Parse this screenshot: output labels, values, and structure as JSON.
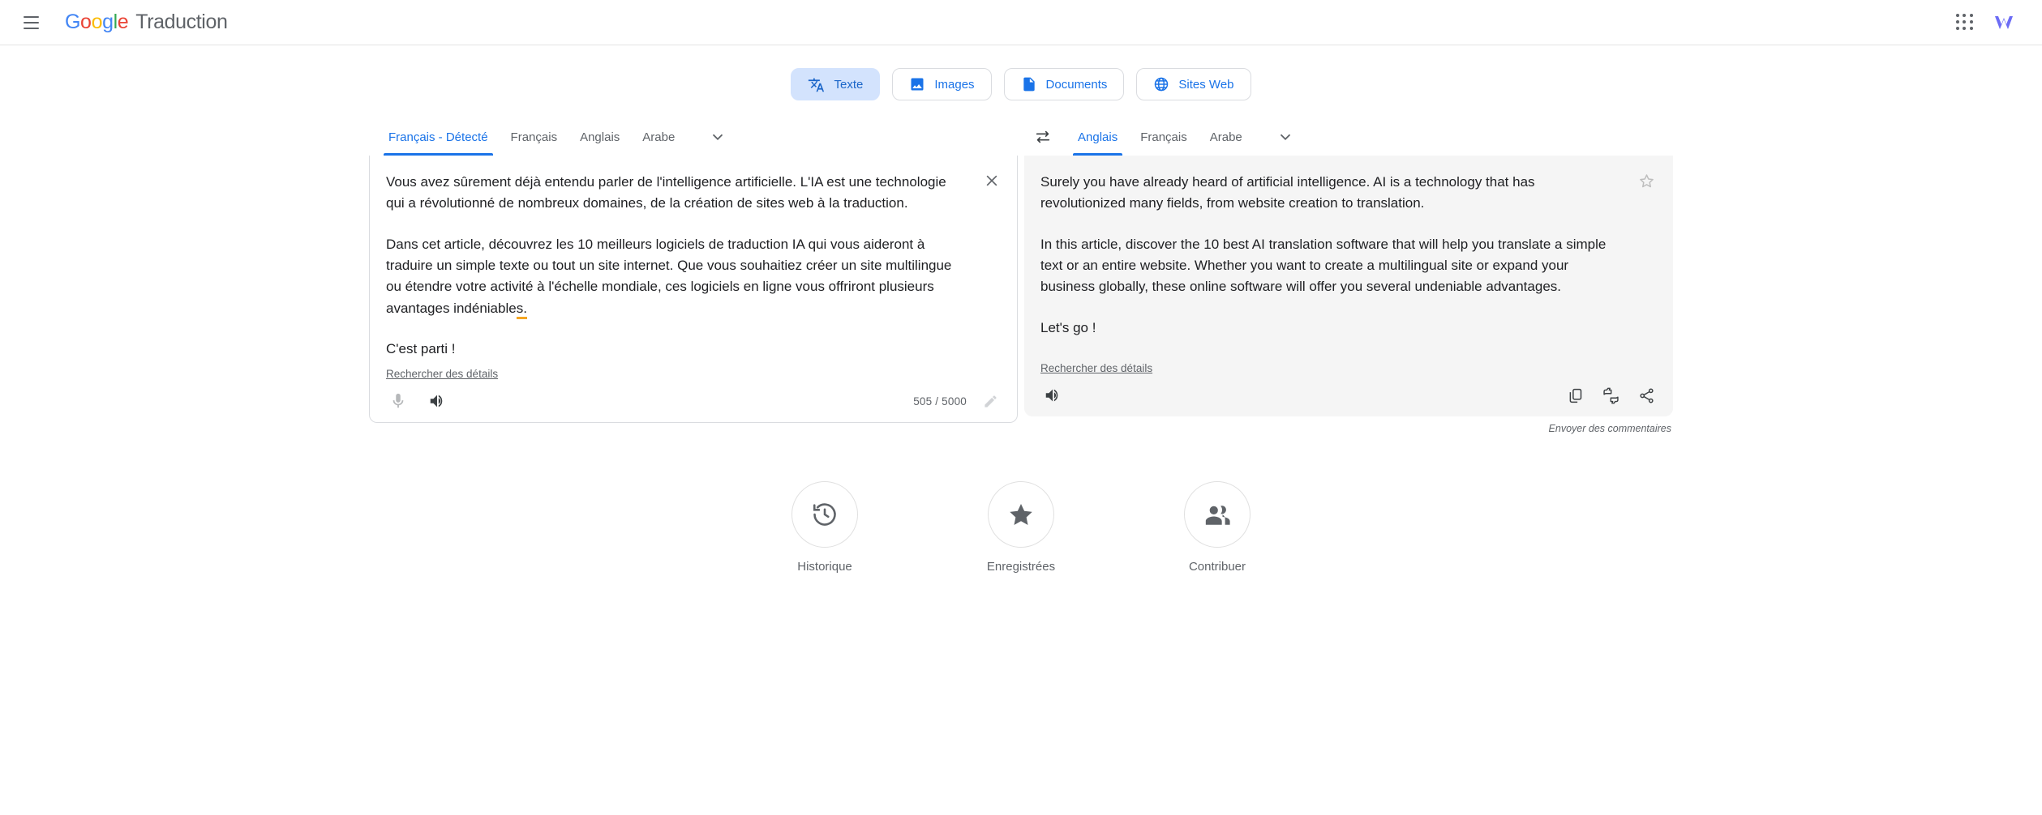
{
  "header": {
    "menu_icon": "hamburger-menu-icon",
    "logo_google": "Google",
    "logo_product": "Traduction",
    "apps_icon": "google-apps-grid-icon",
    "account_icon": "wix-logo-icon"
  },
  "modes": [
    {
      "label": "Texte",
      "icon": "translate-text-icon",
      "active": true
    },
    {
      "label": "Images",
      "icon": "image-icon",
      "active": false
    },
    {
      "label": "Documents",
      "icon": "document-icon",
      "active": false
    },
    {
      "label": "Sites Web",
      "icon": "globe-icon",
      "active": false
    }
  ],
  "source": {
    "languages": [
      {
        "label": "Français - Détecté",
        "active": true
      },
      {
        "label": "Français",
        "active": false
      },
      {
        "label": "Anglais",
        "active": false
      },
      {
        "label": "Arabe",
        "active": false
      }
    ],
    "more_icon": "chevron-down-icon",
    "clear_icon": "close-icon",
    "paragraphs": [
      "Vous avez sûrement déjà entendu parler de l'intelligence artificielle. L'IA est une technologie qui a révolutionné de nombreux domaines, de la création de sites web à la traduction.",
      "Dans cet article, découvrez les 10 meilleurs logiciels de traduction IA qui vous aideront à traduire un simple texte ou tout un site internet. Que vous souhaitiez créer un site multilingue ou étendre votre activité à l'échelle mondiale, ces logiciels en ligne vous offriront plusieurs avantages indéniables.",
      "C'est parti !"
    ],
    "details_link": "Rechercher des détails",
    "mic_icon": "microphone-icon",
    "speaker_icon": "speaker-icon",
    "char_count": "505 / 5000",
    "edit_icon": "pencil-edit-icon"
  },
  "swap": {
    "icon": "swap-languages-icon"
  },
  "target": {
    "languages": [
      {
        "label": "Anglais",
        "active": true
      },
      {
        "label": "Français",
        "active": false
      },
      {
        "label": "Arabe",
        "active": false
      }
    ],
    "more_icon": "chevron-down-icon",
    "star_icon": "star-outline-icon",
    "paragraphs": [
      "Surely you have already heard of artificial intelligence. AI is a technology that has revolutionized many fields, from website creation to translation.",
      "In this article, discover the 10 best AI translation software that will help you translate a simple text or an entire website. Whether you want to create a multilingual site or expand your business globally, these online software will offer you several undeniable advantages.",
      "Let's go !"
    ],
    "details_link": "Rechercher des détails",
    "speaker_icon": "speaker-icon",
    "copy_icon": "copy-icon",
    "rate_icon": "thumbs-up-down-icon",
    "share_icon": "share-icon",
    "feedback_label": "Envoyer des commentaires"
  },
  "bottom_actions": [
    {
      "label": "Historique",
      "icon": "history-icon"
    },
    {
      "label": "Enregistrées",
      "icon": "star-filled-icon"
    },
    {
      "label": "Contribuer",
      "icon": "people-icon"
    }
  ],
  "colors": {
    "accent_blue": "#1a73e8",
    "chip_active_bg": "#d3e3fd",
    "target_panel_bg": "#f5f5f5",
    "grammar_underline": "#f5a623",
    "wix_purple": "#6c6cf5"
  }
}
